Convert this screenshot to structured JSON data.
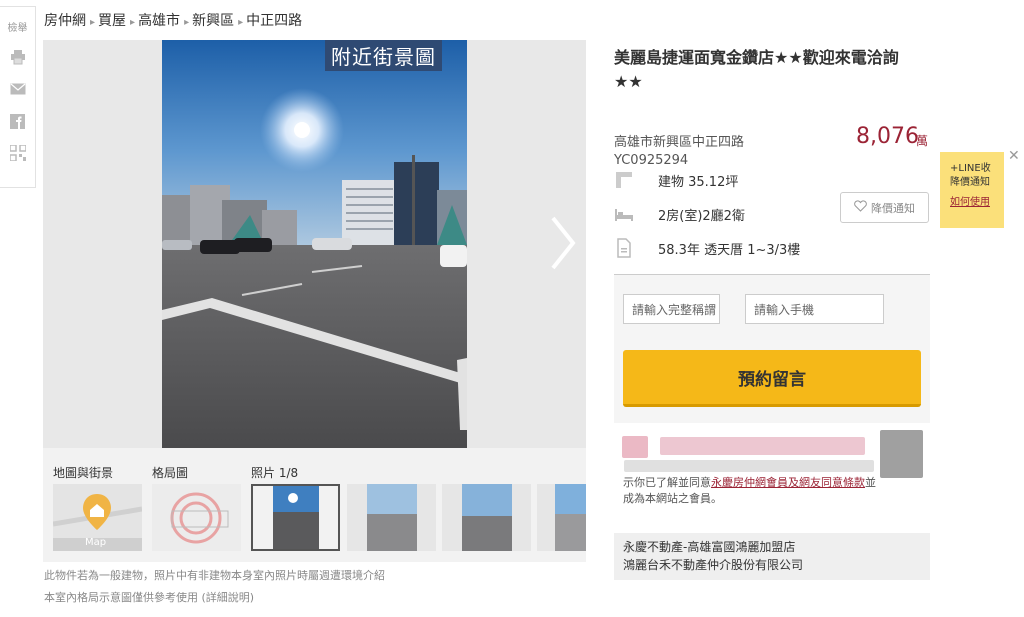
{
  "sharebar": {
    "label": "檢舉"
  },
  "breadcrumb": [
    "房仲網",
    "買屋",
    "高雄市",
    "新興區",
    "中正四路"
  ],
  "gallery": {
    "photo_tag": "附近街景圖"
  },
  "thumbs": {
    "labels": {
      "map": "地圖與街景",
      "layout": "格局圖",
      "photos": "照片 1/8"
    },
    "map_text": "Map"
  },
  "notes": {
    "note1": "此物件若為一般建物，照片中有非建物本身室內照片時屬週遭環境介紹",
    "note2": "本室內格局示意圖僅供參考使用 (詳細說明)"
  },
  "listing": {
    "title": "美麗島捷運面寬金鑽店★★歡迎來電洽詢★★",
    "address": "高雄市新興區中正四路",
    "code": "YC0925294",
    "price": "8,076",
    "price_unit": "萬",
    "specs": {
      "area": "建物 35.12坪",
      "rooms": "2房(室)2廳2衛",
      "age_floor": "58.3年 透天厝 1~3/3樓"
    },
    "notify_label": "降價通知"
  },
  "line_box": {
    "line1": "+LINE收",
    "line2": "降價通知",
    "link": "如何使用",
    "close": "✕"
  },
  "form": {
    "name_placeholder": "請輸入完整稱謂",
    "phone_placeholder": "請輸入手機",
    "reserve_label": "預約留言"
  },
  "consent": {
    "line1": "示你已了解並同意",
    "link1": "永慶房仲網會員及網友同意條款",
    "line2": "並成為本網站之會員。"
  },
  "agent": {
    "store": "永慶不動產-高雄富國鴻麗加盟店",
    "company": "鴻麗台禾不動產仲介股份有限公司"
  },
  "colors": {
    "price": "#9b2335",
    "reserve": "#f5b818",
    "line_box": "#fbe07a"
  }
}
